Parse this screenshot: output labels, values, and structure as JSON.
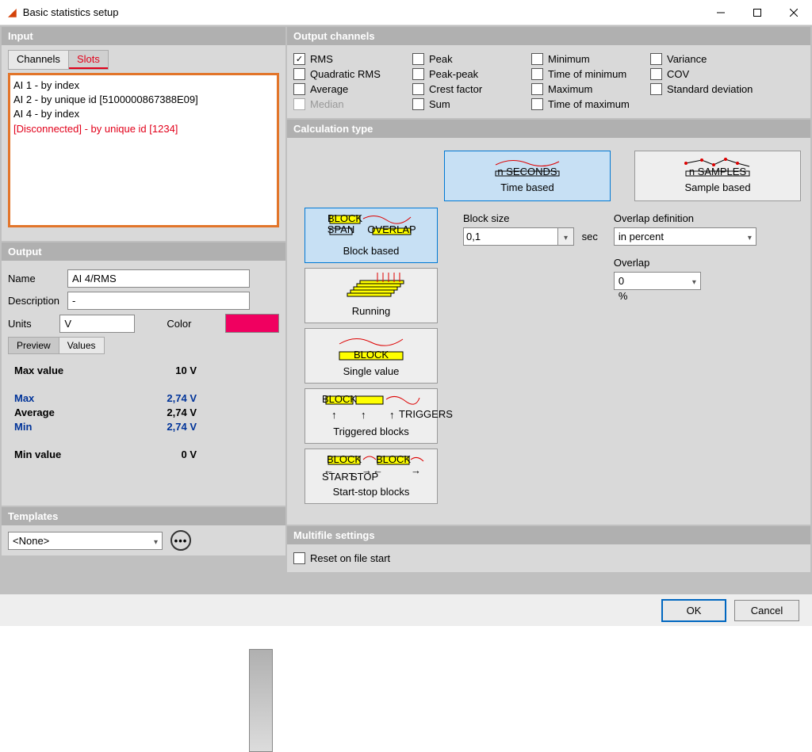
{
  "window": {
    "title": "Basic statistics setup"
  },
  "input": {
    "title": "Input",
    "tabs": {
      "channels": "Channels",
      "slots": "Slots"
    },
    "items": [
      "AI 1 - by index",
      "AI 2 - by unique id [5100000867388E09]",
      "AI 4 - by index",
      "[Disconnected] - by unique id [1234]"
    ]
  },
  "output": {
    "title": "Output",
    "name_label": "Name",
    "name": "AI 4/RMS",
    "desc_label": "Description",
    "desc": "-",
    "units_label": "Units",
    "units": "V",
    "color_label": "Color",
    "color": "#f00060",
    "tabs": {
      "preview": "Preview",
      "values": "Values"
    },
    "preview": {
      "max_value_lbl": "Max value",
      "max_value": "10 V",
      "max_lbl": "Max",
      "max": "2,74 V",
      "avg_lbl": "Average",
      "avg": "2,74 V",
      "min_lbl": "Min",
      "min": "2,74 V",
      "min_value_lbl": "Min value",
      "min_value": "0 V"
    }
  },
  "templates": {
    "title": "Templates",
    "value": "<None>"
  },
  "output_channels": {
    "title": "Output channels",
    "items": {
      "rms": "RMS",
      "qrms": "Quadratic RMS",
      "avg": "Average",
      "median": "Median",
      "peak": "Peak",
      "peakpeak": "Peak-peak",
      "crest": "Crest factor",
      "sum": "Sum",
      "min": "Minimum",
      "tmin": "Time of minimum",
      "max": "Maximum",
      "tmax": "Time of maximum",
      "var": "Variance",
      "cov": "COV",
      "std": "Standard deviation"
    },
    "checked": [
      "rms"
    ],
    "disabled": [
      "median"
    ]
  },
  "calc": {
    "title": "Calculation type",
    "time_based": "Time based",
    "sample_based": "Sample based",
    "block_based": "Block based",
    "running": "Running",
    "single_value": "Single value",
    "trig_blocks": "Triggered blocks",
    "ss_blocks": "Start-stop blocks",
    "block_size_lbl": "Block size",
    "block_size": "0,1",
    "block_unit": "sec",
    "overlap_def_lbl": "Overlap definition",
    "overlap_def": "in percent",
    "overlap_lbl": "Overlap",
    "overlap": "0",
    "overlap_unit": "%"
  },
  "multi": {
    "title": "Multifile settings",
    "reset": "Reset on file start"
  },
  "buttons": {
    "ok": "OK",
    "cancel": "Cancel"
  }
}
